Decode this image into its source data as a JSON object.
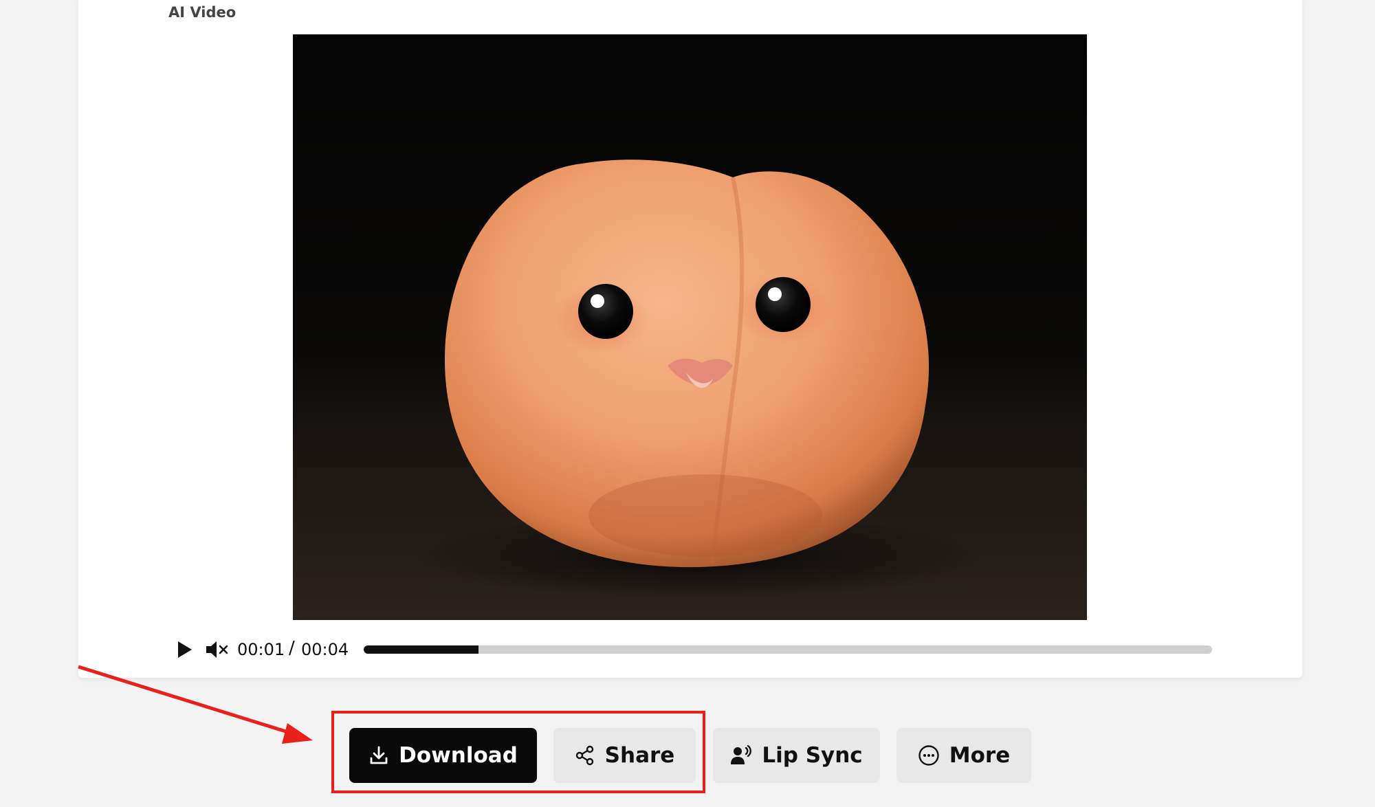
{
  "section_label": "AI Video",
  "player": {
    "current_time": "00:01",
    "separator": "/",
    "total_time": "00:04",
    "progress_fraction": 0.135,
    "play_icon": "play-icon",
    "mute_icon": "volume-muted-icon"
  },
  "actions": {
    "download_label": "Download",
    "share_label": "Share",
    "lipsync_label": "Lip Sync",
    "more_label": "More"
  },
  "colors": {
    "highlight": "#e8221b",
    "primary_button": "#0a0a0a",
    "secondary_button": "#e8e8e8"
  }
}
